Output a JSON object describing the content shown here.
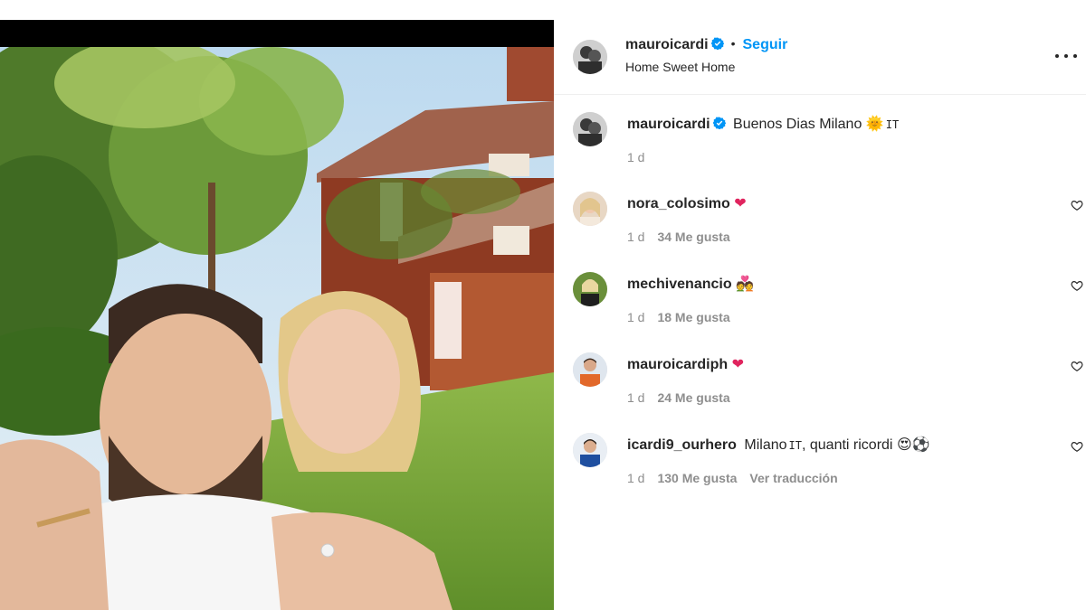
{
  "post": {
    "author": "mauroicardi",
    "follow_label": "Seguir",
    "location": "Home Sweet Home"
  },
  "caption": {
    "username": "mauroicardi",
    "text": "Buenos Dias Milano",
    "emoji_sun": "🌞",
    "flag": "IT",
    "time": "1 d"
  },
  "comments": [
    {
      "username": "nora_colosimo",
      "text": "",
      "emoji": "❤",
      "time": "1 d",
      "likes": "34 Me gusta"
    },
    {
      "username": "mechivenancio",
      "text": "",
      "emoji": "💑",
      "time": "1 d",
      "likes": "18 Me gusta"
    },
    {
      "username": "mauroicardiph",
      "text": "",
      "emoji": "❤",
      "time": "1 d",
      "likes": "24 Me gusta"
    },
    {
      "username": "icardi9_ourhero",
      "text": "Milano",
      "flag": "IT",
      "text2": ", quanti ricordi",
      "emoji": "😍⚽",
      "time": "1 d",
      "likes": "130 Me gusta",
      "translate": "Ver traducción"
    }
  ],
  "icons": {
    "verified": "verified-badge-icon",
    "more": "more-options-icon",
    "like": "heart-outline-icon"
  },
  "colors": {
    "accent": "#0095f6",
    "verified": "#0095f6",
    "heart": "#e0245e",
    "muted": "#8e8e8e"
  }
}
